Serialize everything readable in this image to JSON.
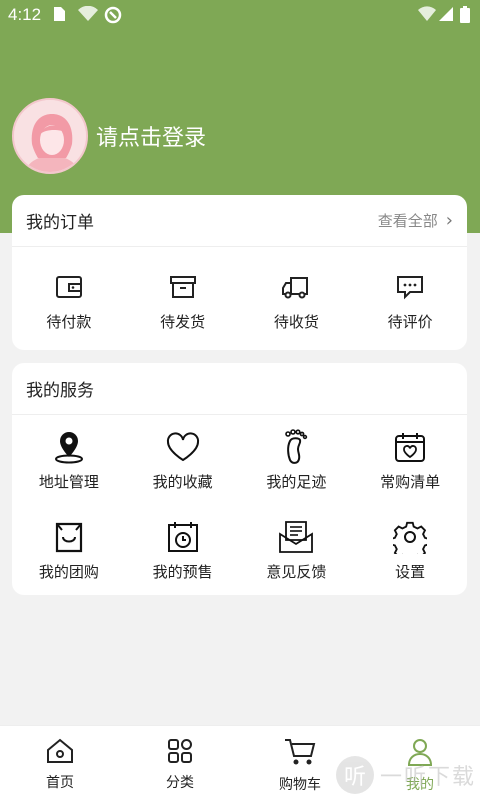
{
  "status": {
    "time": "4:12",
    "icons": [
      "sim-card-icon",
      "wifi-question-icon",
      "sync-icon",
      "wifi-icon",
      "signal-icon",
      "battery-icon"
    ]
  },
  "colors": {
    "accent": "#7fa855",
    "background": "#f2f2f2",
    "card": "#ffffff"
  },
  "profile": {
    "login_text": "请点击登录"
  },
  "orders": {
    "title": "我的订单",
    "view_all": "查看全部",
    "items": [
      {
        "label": "待付款",
        "icon": "wallet-icon"
      },
      {
        "label": "待发货",
        "icon": "box-icon"
      },
      {
        "label": "待收货",
        "icon": "truck-icon"
      },
      {
        "label": "待评价",
        "icon": "comment-icon"
      }
    ]
  },
  "services": {
    "title": "我的服务",
    "items": [
      {
        "label": "地址管理",
        "icon": "location-pin-icon"
      },
      {
        "label": "我的收藏",
        "icon": "heart-icon"
      },
      {
        "label": "我的足迹",
        "icon": "footprint-icon"
      },
      {
        "label": "常购清单",
        "icon": "calendar-heart-icon"
      },
      {
        "label": "我的团购",
        "icon": "shopping-bag-icon"
      },
      {
        "label": "我的预售",
        "icon": "calendar-clock-icon"
      },
      {
        "label": "意见反馈",
        "icon": "feedback-mail-icon"
      },
      {
        "label": "设置",
        "icon": "gear-icon"
      }
    ]
  },
  "tabbar": {
    "items": [
      {
        "label": "首页",
        "icon": "home-icon"
      },
      {
        "label": "分类",
        "icon": "category-icon"
      },
      {
        "label": "购物车",
        "icon": "cart-icon"
      },
      {
        "label": "我的",
        "icon": "user-icon",
        "active": true
      }
    ]
  },
  "watermark": {
    "badge": "听",
    "text": "一听下载"
  }
}
